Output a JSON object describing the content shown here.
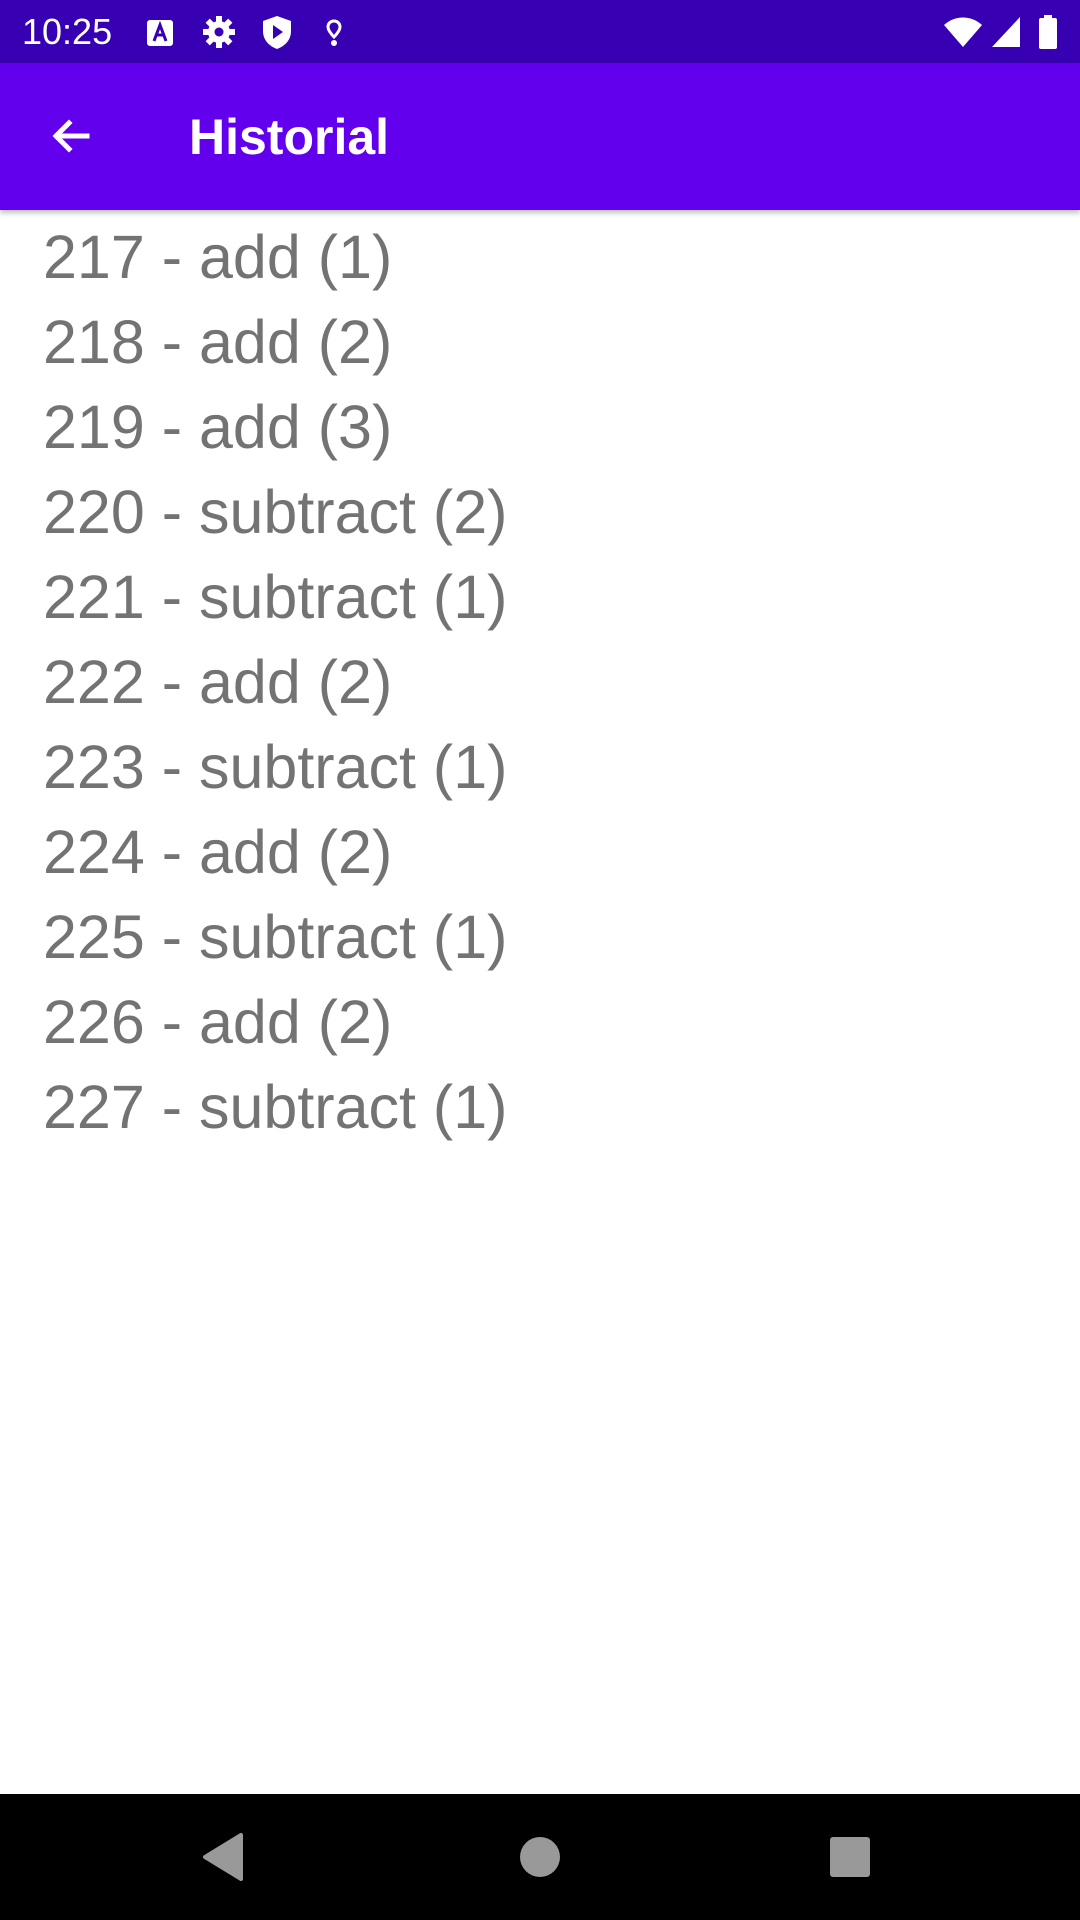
{
  "status_bar": {
    "time": "10:25",
    "icons": [
      "keyboard-a-icon",
      "gear-icon",
      "shield-play-icon",
      "location-pin-icon",
      "wifi-icon",
      "cell-signal-icon",
      "battery-icon"
    ]
  },
  "app_bar": {
    "title": "Historial",
    "back_icon": "arrow-left-icon"
  },
  "history": {
    "items": [
      "217 - add (1)",
      "218 - add (2)",
      "219 - add (3)",
      "220 - subtract (2)",
      "221 - subtract (1)",
      "222 - add (2)",
      "223 - subtract (1)",
      "224 - add (2)",
      "225 - subtract (1)",
      "226 - add (2)",
      "227 - subtract (1)"
    ]
  },
  "nav_bar": {
    "buttons": [
      "back-triangle-icon",
      "home-circle-icon",
      "recents-square-icon"
    ]
  },
  "colors": {
    "status_bar": "#3700b3",
    "app_bar": "#6200ee",
    "list_text": "#737373",
    "nav_bar": "#000000"
  }
}
